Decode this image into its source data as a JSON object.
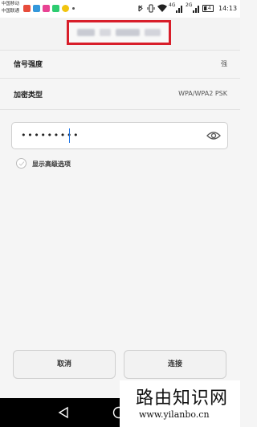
{
  "status_bar": {
    "carrier_1": "中国移动",
    "carrier_2": "中国联通",
    "app_icon_colors": [
      "#e74c3c",
      "#3498db",
      "#e84393",
      "#2ecc71",
      "#f1c40f"
    ],
    "network_4g": "4G",
    "network_2g": "2G",
    "battery": "14",
    "time": "14:13"
  },
  "network": {
    "ssid": ""
  },
  "rows": [
    {
      "label": "信号强度",
      "value": "强"
    },
    {
      "label": "加密类型",
      "value": "WPA/WPA2 PSK"
    }
  ],
  "password": {
    "value": "•••••••••"
  },
  "advanced": {
    "label": "显示高级选项"
  },
  "buttons": {
    "cancel": "取消",
    "connect": "连接"
  },
  "watermark": {
    "title": "路由知识网",
    "url": "www.yilanbo.cn"
  },
  "colors": {
    "highlight_box": "#d81e2a",
    "cursor": "#1a73e8"
  }
}
